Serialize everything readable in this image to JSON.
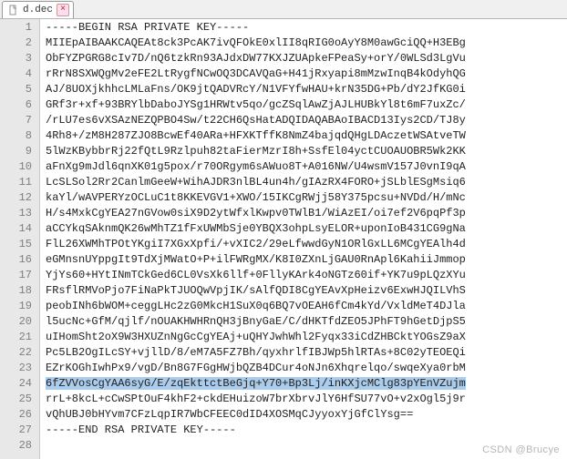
{
  "tab": {
    "filename": "d.dec",
    "close_tooltip": "Close"
  },
  "watermark": "CSDN @Brucye",
  "editor": {
    "highlighted_line_index": 23,
    "lines": [
      "-----BEGIN RSA PRIVATE KEY-----",
      "MIIEpAIBAAKCAQEAt8ck3PcAK7ivQFOkE0xlII8qRIG0oAyY8M0awGciQQ+H3EBg",
      "ObFYZPGRG8cIv7D/nQ6tzkRn93AJdxDW77KXJZUApkeFPeaSy+orY/0WLSd3LgVu",
      "rRrN8SXWQgMv2eFE2LtRygfNCwOQ3DCAVQaG+H41jRxyapi8mMzwInqB4kOdyhQG",
      "AJ/8UOXjkhhcLMLaFns/OK9jtQADVRcY/N1VFYfwHAU+krN35DG+Pb/dY2JfKG0i",
      "GRf3r+xf+93BRYlbDaboJYSg1HRWtv5qo/gcZSqlAwZjAJLHUBkYl8t6mF7uxZc/",
      "/rLU7es6vXSAzNEZQPBO4Sw/t22CH6QsHatADQIDAQABAoIBACD13Iys2CD/TJ8y",
      "4Rh8+/zM8H287ZJO8BcwEf40ARa+HFXKTffK8NmZ4bajqdQHgLDAczetWSAtveTW",
      "5lWzKBybbrRj22fQtL9Rzlpuh82taFierMzrI8h+SsfEl04yctCUOAUOBR5Wk2KK",
      "aFnXg9mJdl6qnXK01g5pox/r70ORgym6sAWuo8T+A016NW/U4wsmV157J0vnI9qA",
      "LcSLSol2Rr2CanlmGeeW+WihAJDR3nlBL4un4h/gIAzRX4FORO+jSLblESgMsiq6",
      "kaYl/wAVPERYzOCLuC1t8KKEVGV1+XWO/15IKCgRWjj58Y375pcsu+NVDd/H/mNc",
      "H/s4MxkCgYEA27nGVow0siX9D2ytWfxlKwpv0TWlB1/WiAzEI/oi7ef2V6pqPf3p",
      "aCCYkqSAknmQK26wMhTZ1fFxUWMbSje0YBQX3ohpLsyELOR+uponIoB431CG9gNa",
      "FlL26XWMhTPOtYKgiI7XGxXpfi/+vXIC2/29eLfwwdGyN1ORlGxLL6MCgYEAlh4d",
      "eGMnsnUYppgIt9TdXjMWatO+P+ilFWRgMX/K8I0ZXnLjGAU0RnApl6KahiiJmmop",
      "YjYs60+HYtINmTCkGed6CL0VsXk6llf+0FllyKArk4oNGTz60if+YK7u9pLQzXYu",
      "FRsflRMVoPjo7FiNaPkTJUOQwVpjIK/sAlfQDI8CgYEAvXpHeizv6ExwHJQILVhS",
      "peobINh6bWOM+ceggLHc2zG0MkcH1SuX0q6BQ7vOEAH6fCm4kYd/VxldMeT4DJla",
      "l5ucNc+GfM/qjlf/nOUAKHWHRnQH3jBnyGaE/C/dHKTfdZEO5JPhFT9hGetDjpS5",
      "uIHomSht2oX9W3HXUZnNgGcCgYEAj+uQHYJwhWhl2Fyqx33iCdZHBCktYOGsZ9aX",
      "Pc5LB2OgILcSY+vjllD/8/eM7A5FZ7Bh/qyxhrlfIBJWp5hlRTAs+8C02yTEOEQi",
      "EZrKOGhIwhPx9/vgD/Bn8G7FGgHWjbQZB4DCur4oNJn6Xhqrelqo/swqeXya0rbM",
      "6fZVVosCgYAA6syG/E/zqEkttctBeGjq+Y70+Bp3Lj/inKXjcMClg83pYEnVZujm",
      "rrL+8kcL+cCwSPtOuF4khF2+ckdEHuizoW7brXbrvJlY6HfSU77vO+v2xOgl5j9r",
      "vQhUBJ0bHYvm7CFzLqpIR7WbCFEEC0dID4XOSMqCJyyoxYjGfClYsg==",
      "-----END RSA PRIVATE KEY-----",
      ""
    ]
  }
}
